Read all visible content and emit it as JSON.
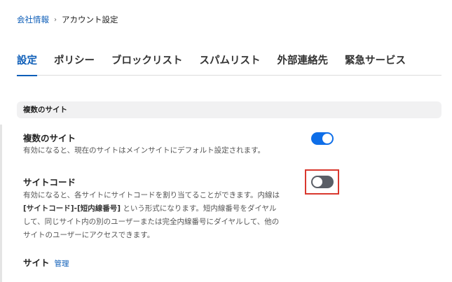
{
  "breadcrumb": {
    "parent": "会社情報",
    "current": "アカウント設定"
  },
  "tabs": [
    {
      "label": "設定",
      "active": true
    },
    {
      "label": "ポリシー",
      "active": false
    },
    {
      "label": "ブロックリスト",
      "active": false
    },
    {
      "label": "スパムリスト",
      "active": false
    },
    {
      "label": "外部連絡先",
      "active": false
    },
    {
      "label": "緊急サービス",
      "active": false
    }
  ],
  "section": {
    "title": "複数のサイト"
  },
  "settings": {
    "multi_site": {
      "title": "複数のサイト",
      "description": "有効になると、現在のサイトはメインサイトにデフォルト設定されます。",
      "enabled": true
    },
    "site_code": {
      "title": "サイトコード",
      "desc_line1": "有効になると、各サイトにサイトコードを割り当てることができます。内線は",
      "desc_bold": "[サイトコード]-[短内線番号]",
      "desc_line2_rest": " という形式になります。短内線番号をダイヤル",
      "desc_line3": "して、同じサイト内の別のユーザーまたは完全内線番号にダイヤルして、他の",
      "desc_line4": "サイトのユーザーにアクセスできます。",
      "enabled": false
    },
    "site": {
      "label": "サイト",
      "manage_link": "管理"
    }
  },
  "colors": {
    "accent": "#0e5eb8",
    "toggle_on": "#0e6ee8",
    "toggle_off": "#5a5e66",
    "highlight": "#d9382e"
  }
}
